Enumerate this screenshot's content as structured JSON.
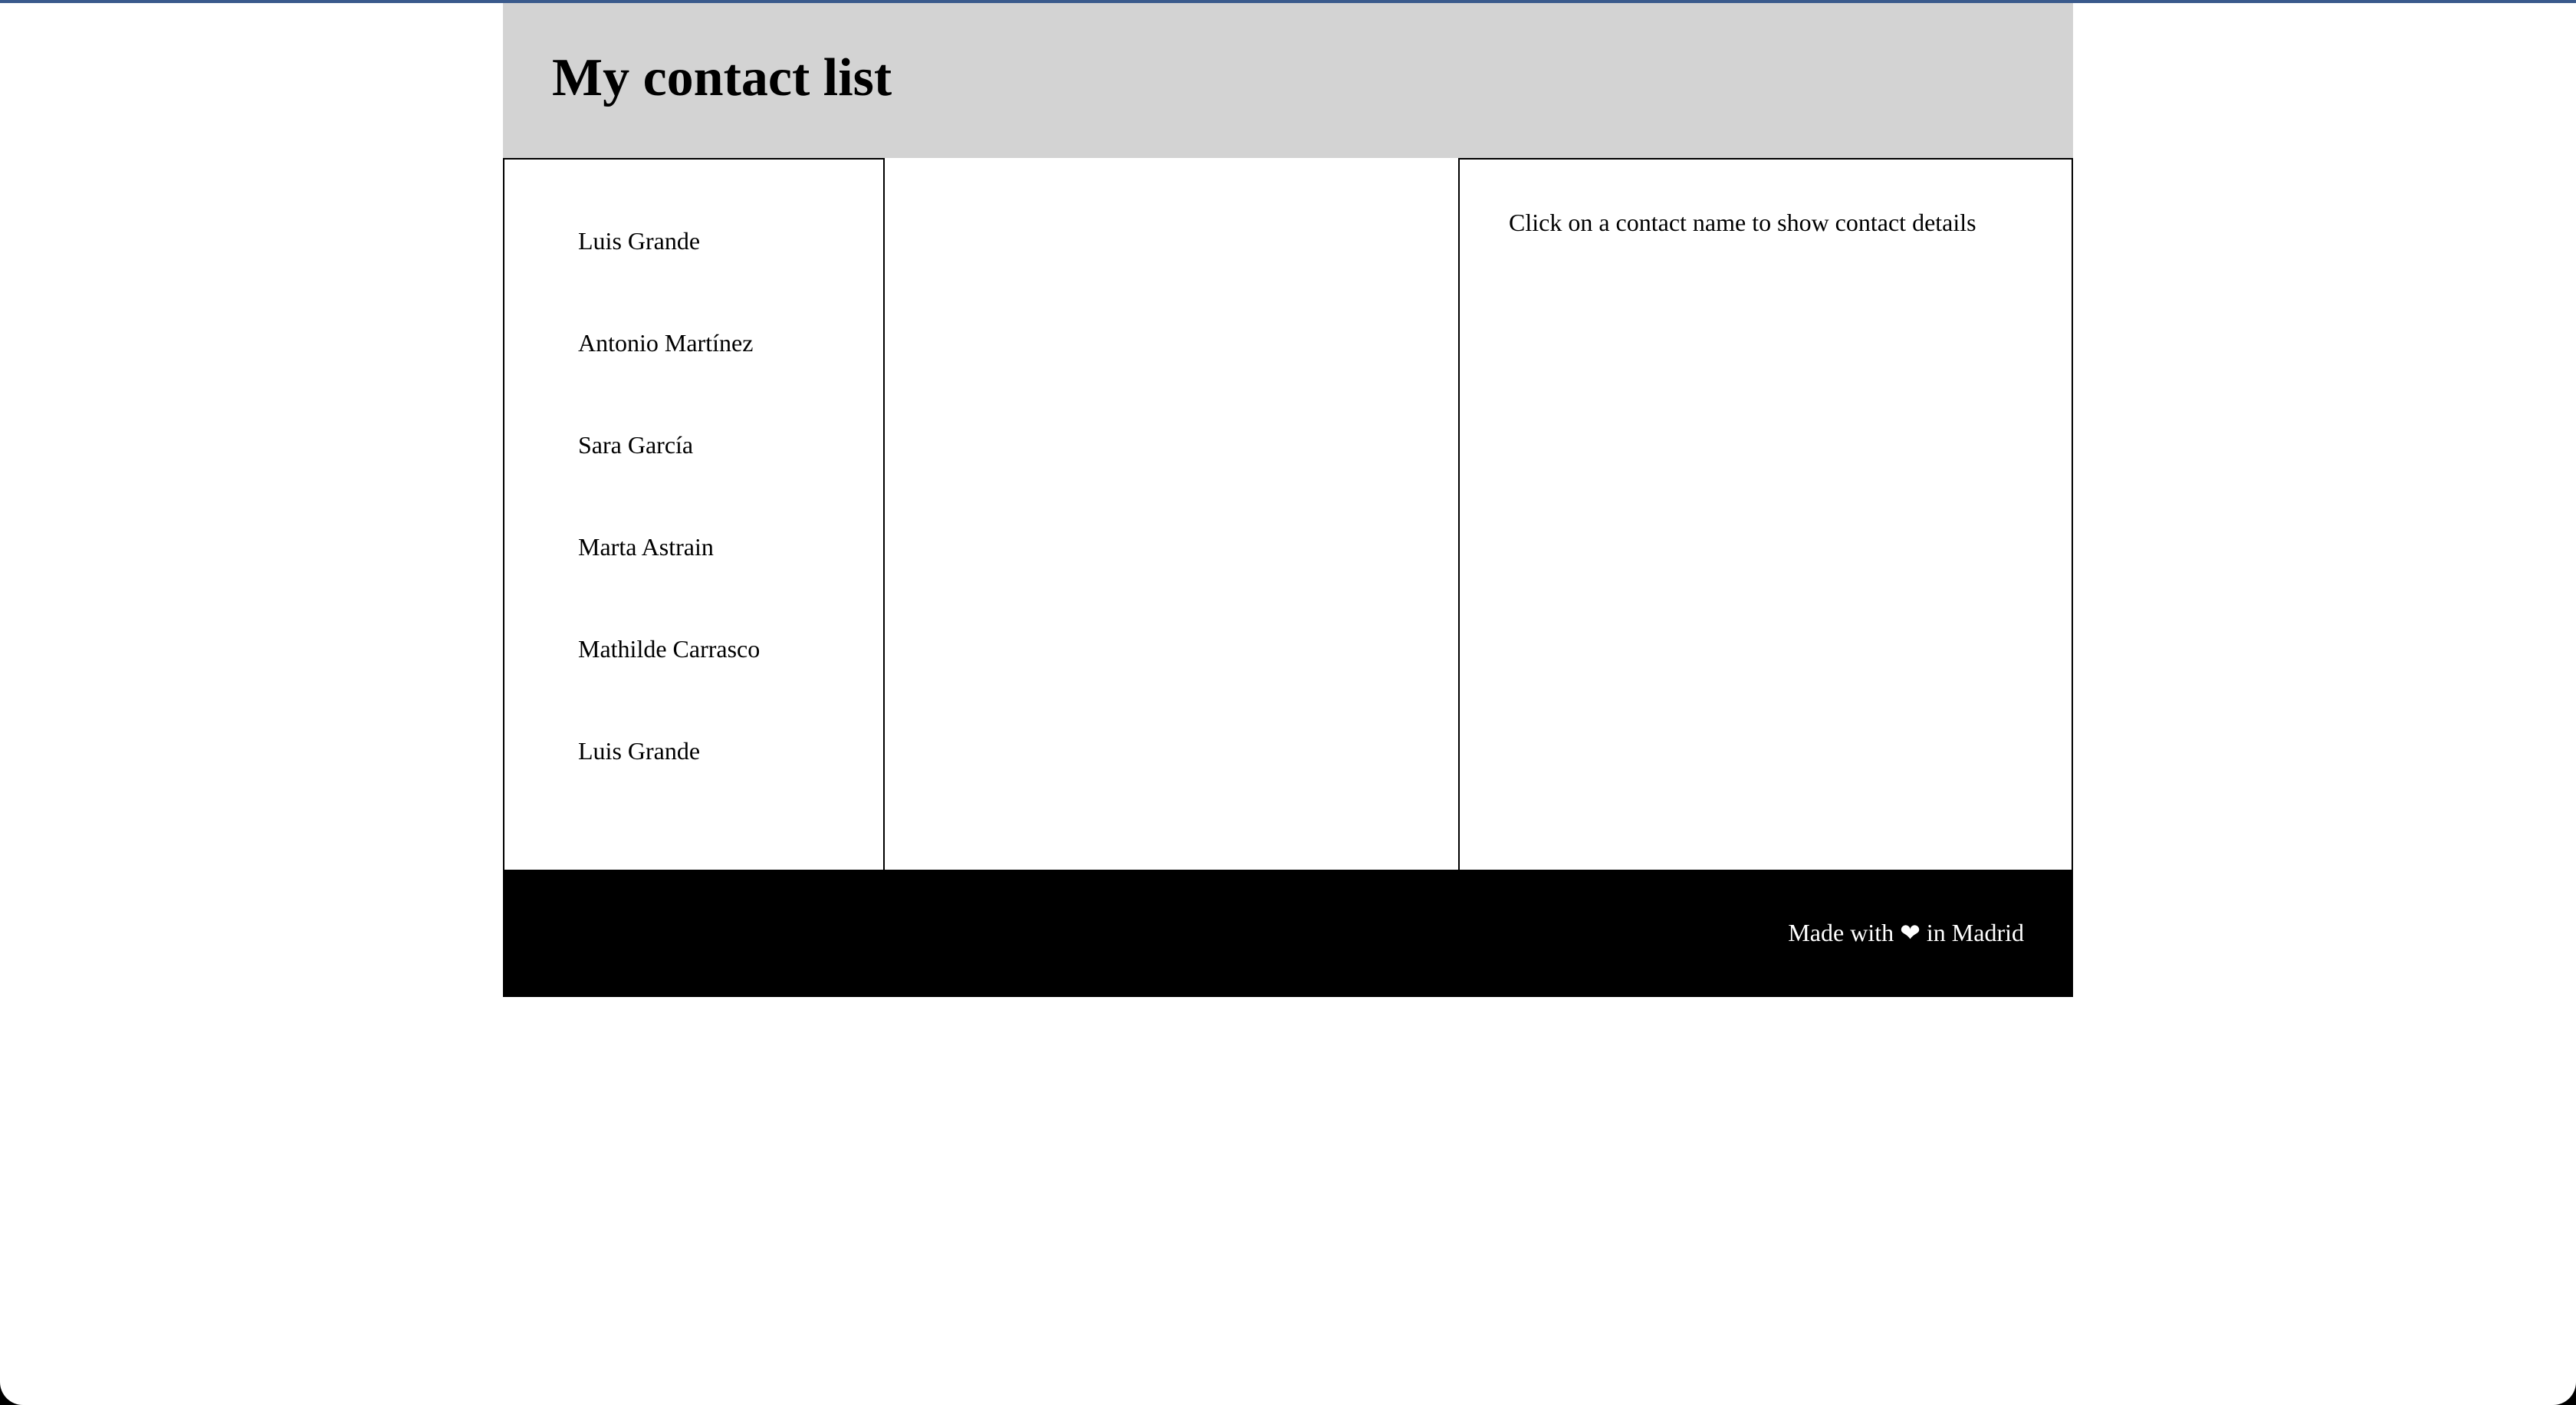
{
  "header": {
    "title": "My contact list"
  },
  "contacts": [
    {
      "name": "Luis Grande"
    },
    {
      "name": "Antonio Martínez"
    },
    {
      "name": "Sara García"
    },
    {
      "name": "Marta Astrain"
    },
    {
      "name": "Mathilde Carrasco"
    },
    {
      "name": "Luis Grande"
    }
  ],
  "details": {
    "hint": "Click on a contact name to show contact details"
  },
  "footer": {
    "prefix": "Made with",
    "heart": "❤",
    "suffix": "in Madrid"
  },
  "colors": {
    "header_bg": "#d3d3d3",
    "footer_bg": "#000000",
    "footer_text": "#ffffff",
    "top_accent": "#3a5a8c"
  },
  "icons": {
    "heart": "heart-icon"
  }
}
